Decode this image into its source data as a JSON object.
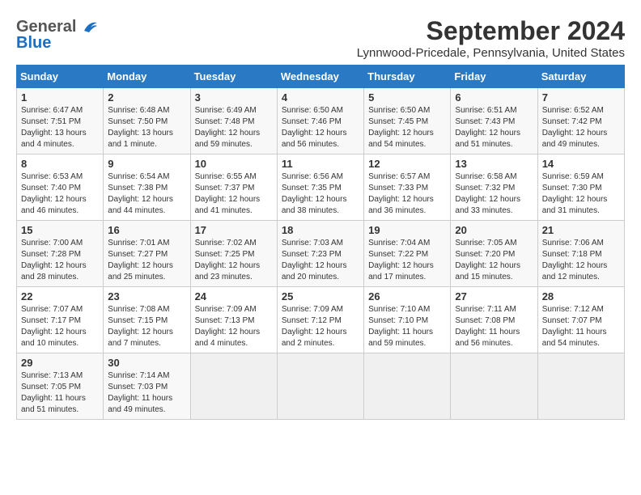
{
  "header": {
    "logo_general": "General",
    "logo_blue": "Blue",
    "title": "September 2024",
    "subtitle": "Lynnwood-Pricedale, Pennsylvania, United States"
  },
  "calendar": {
    "days_of_week": [
      "Sunday",
      "Monday",
      "Tuesday",
      "Wednesday",
      "Thursday",
      "Friday",
      "Saturday"
    ],
    "weeks": [
      [
        {
          "day": "1",
          "sunrise": "6:47 AM",
          "sunset": "7:51 PM",
          "daylight": "13 hours and 4 minutes."
        },
        {
          "day": "2",
          "sunrise": "6:48 AM",
          "sunset": "7:50 PM",
          "daylight": "13 hours and 1 minute."
        },
        {
          "day": "3",
          "sunrise": "6:49 AM",
          "sunset": "7:48 PM",
          "daylight": "12 hours and 59 minutes."
        },
        {
          "day": "4",
          "sunrise": "6:50 AM",
          "sunset": "7:46 PM",
          "daylight": "12 hours and 56 minutes."
        },
        {
          "day": "5",
          "sunrise": "6:50 AM",
          "sunset": "7:45 PM",
          "daylight": "12 hours and 54 minutes."
        },
        {
          "day": "6",
          "sunrise": "6:51 AM",
          "sunset": "7:43 PM",
          "daylight": "12 hours and 51 minutes."
        },
        {
          "day": "7",
          "sunrise": "6:52 AM",
          "sunset": "7:42 PM",
          "daylight": "12 hours and 49 minutes."
        }
      ],
      [
        {
          "day": "8",
          "sunrise": "6:53 AM",
          "sunset": "7:40 PM",
          "daylight": "12 hours and 46 minutes."
        },
        {
          "day": "9",
          "sunrise": "6:54 AM",
          "sunset": "7:38 PM",
          "daylight": "12 hours and 44 minutes."
        },
        {
          "day": "10",
          "sunrise": "6:55 AM",
          "sunset": "7:37 PM",
          "daylight": "12 hours and 41 minutes."
        },
        {
          "day": "11",
          "sunrise": "6:56 AM",
          "sunset": "7:35 PM",
          "daylight": "12 hours and 38 minutes."
        },
        {
          "day": "12",
          "sunrise": "6:57 AM",
          "sunset": "7:33 PM",
          "daylight": "12 hours and 36 minutes."
        },
        {
          "day": "13",
          "sunrise": "6:58 AM",
          "sunset": "7:32 PM",
          "daylight": "12 hours and 33 minutes."
        },
        {
          "day": "14",
          "sunrise": "6:59 AM",
          "sunset": "7:30 PM",
          "daylight": "12 hours and 31 minutes."
        }
      ],
      [
        {
          "day": "15",
          "sunrise": "7:00 AM",
          "sunset": "7:28 PM",
          "daylight": "12 hours and 28 minutes."
        },
        {
          "day": "16",
          "sunrise": "7:01 AM",
          "sunset": "7:27 PM",
          "daylight": "12 hours and 25 minutes."
        },
        {
          "day": "17",
          "sunrise": "7:02 AM",
          "sunset": "7:25 PM",
          "daylight": "12 hours and 23 minutes."
        },
        {
          "day": "18",
          "sunrise": "7:03 AM",
          "sunset": "7:23 PM",
          "daylight": "12 hours and 20 minutes."
        },
        {
          "day": "19",
          "sunrise": "7:04 AM",
          "sunset": "7:22 PM",
          "daylight": "12 hours and 17 minutes."
        },
        {
          "day": "20",
          "sunrise": "7:05 AM",
          "sunset": "7:20 PM",
          "daylight": "12 hours and 15 minutes."
        },
        {
          "day": "21",
          "sunrise": "7:06 AM",
          "sunset": "7:18 PM",
          "daylight": "12 hours and 12 minutes."
        }
      ],
      [
        {
          "day": "22",
          "sunrise": "7:07 AM",
          "sunset": "7:17 PM",
          "daylight": "12 hours and 10 minutes."
        },
        {
          "day": "23",
          "sunrise": "7:08 AM",
          "sunset": "7:15 PM",
          "daylight": "12 hours and 7 minutes."
        },
        {
          "day": "24",
          "sunrise": "7:09 AM",
          "sunset": "7:13 PM",
          "daylight": "12 hours and 4 minutes."
        },
        {
          "day": "25",
          "sunrise": "7:09 AM",
          "sunset": "7:12 PM",
          "daylight": "12 hours and 2 minutes."
        },
        {
          "day": "26",
          "sunrise": "7:10 AM",
          "sunset": "7:10 PM",
          "daylight": "11 hours and 59 minutes."
        },
        {
          "day": "27",
          "sunrise": "7:11 AM",
          "sunset": "7:08 PM",
          "daylight": "11 hours and 56 minutes."
        },
        {
          "day": "28",
          "sunrise": "7:12 AM",
          "sunset": "7:07 PM",
          "daylight": "11 hours and 54 minutes."
        }
      ],
      [
        {
          "day": "29",
          "sunrise": "7:13 AM",
          "sunset": "7:05 PM",
          "daylight": "11 hours and 51 minutes."
        },
        {
          "day": "30",
          "sunrise": "7:14 AM",
          "sunset": "7:03 PM",
          "daylight": "11 hours and 49 minutes."
        },
        {
          "day": "",
          "sunrise": "",
          "sunset": "",
          "daylight": ""
        },
        {
          "day": "",
          "sunrise": "",
          "sunset": "",
          "daylight": ""
        },
        {
          "day": "",
          "sunrise": "",
          "sunset": "",
          "daylight": ""
        },
        {
          "day": "",
          "sunrise": "",
          "sunset": "",
          "daylight": ""
        },
        {
          "day": "",
          "sunrise": "",
          "sunset": "",
          "daylight": ""
        }
      ]
    ]
  },
  "labels": {
    "sunrise": "Sunrise:",
    "sunset": "Sunset:",
    "daylight": "Daylight:"
  }
}
